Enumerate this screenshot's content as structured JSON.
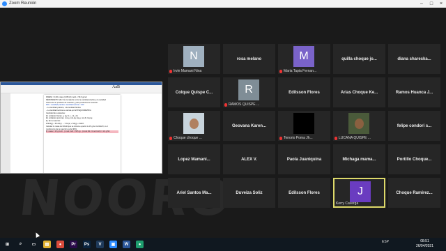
{
  "window": {
    "title": "Zoom Reunión"
  },
  "shared_doc": {
    "ribbon_text": "AaB",
    "lines": [
      "P(REN) = 0,36 moles·(3,05/4,6) mol/L × 59,6 g/mol",
      "",
      "RENDIMIENTO (R) = Es la relación entre la cantidad práctica y la cantidad",
      "teórica de un producto de reacción y para productos de reacción:",
      "R% = cantidad práctica / cantidad teórica × 100",
      "– La cantidad práctica, o la cantidad fáctica",
      "– La cantidad teórica se calcula por ESTEQUIOMETRÍA",
      "Cantidad de sustancias:",
      "En unidades físicas: g, kg, lb, L, mL, dm",
      "En unidades químicas: mol-g, mol-kg, Eq-g, mol-lb, Eq-kg",
      "Ej. En la reacción:",
      "2NH3(g) + 3CuO(s) → 3 Cu(s) + N2(g) + 3H2O",
      "Calcular la masa de N2/H2 que se obtiene a partir de 15 g de CuO/H2O, si el",
      "rendimiento de la reacción es del 90%.",
      "R: masa = 15 g CuO · (1 mol CuO / 79,5 g) · (1 mol N2 / 3 mol CuO) = 1,6 g N2"
    ]
  },
  "watermark": "NOORO",
  "participants": [
    {
      "name": "N",
      "footer": "Irvin Mamani Nina",
      "type": "avatar",
      "color": "#9fb0bf",
      "mic_muted": true
    },
    {
      "name": "rosa melano",
      "footer": "",
      "type": "name",
      "mic_muted": false
    },
    {
      "name": "M",
      "footer": "Maria Tapia Fernan...",
      "type": "avatar",
      "color": "#7a63c9",
      "mic_muted": true
    },
    {
      "name": "quilla choque jo...",
      "footer": "",
      "type": "name",
      "mic_muted": false
    },
    {
      "name": "diana shareska...",
      "footer": "",
      "type": "name",
      "mic_muted": false
    },
    {
      "name": "Colque Quispe C...",
      "footer": "",
      "type": "name",
      "mic_muted": false
    },
    {
      "name": "R",
      "footer": "RAMOS QUISPE ...",
      "type": "avatar",
      "color": "#7f8d96",
      "mic_muted": true
    },
    {
      "name": "Edilsson Flores",
      "footer": "",
      "type": "name",
      "mic_muted": false
    },
    {
      "name": "Arias Choque Ke...",
      "footer": "",
      "type": "name",
      "mic_muted": false
    },
    {
      "name": "Ramos Huanca J...",
      "footer": "",
      "type": "name",
      "mic_muted": false
    },
    {
      "name": "",
      "footer": "Choque choque ...",
      "type": "photo",
      "mic_muted": true
    },
    {
      "name": "Geovana Karen...",
      "footer": "",
      "type": "name",
      "mic_muted": false
    },
    {
      "name": "",
      "footer": "Tenorio Poma Jh...",
      "type": "black",
      "mic_muted": true
    },
    {
      "name": "",
      "footer": "LUCANA QUISPE ...",
      "type": "photo2",
      "mic_muted": true
    },
    {
      "name": "felipe condori s...",
      "footer": "",
      "type": "name",
      "mic_muted": false
    },
    {
      "name": "Lopez Mamani...",
      "footer": "",
      "type": "name",
      "mic_muted": false
    },
    {
      "name": "ALEX V.",
      "footer": "",
      "type": "name",
      "mic_muted": false
    },
    {
      "name": "Paola Juaniquina",
      "footer": "",
      "type": "name",
      "mic_muted": false
    },
    {
      "name": "Michaga mama...",
      "footer": "",
      "type": "name",
      "mic_muted": false
    },
    {
      "name": "Portillo Choque...",
      "footer": "",
      "type": "name",
      "mic_muted": false
    },
    {
      "name": "Ariel Santos Ma...",
      "footer": "",
      "type": "name",
      "mic_muted": false
    },
    {
      "name": "Duveiza Soliz",
      "footer": "",
      "type": "name",
      "mic_muted": false
    },
    {
      "name": "Edilsson Flores",
      "footer": "",
      "type": "name",
      "mic_muted": false
    },
    {
      "name": "J",
      "footer": "Kerry Caverga",
      "type": "avatar",
      "color": "#6a3cc0",
      "mic_muted": false,
      "active": true
    },
    {
      "name": "Choque Ramirez...",
      "footer": "",
      "type": "name",
      "mic_muted": false
    }
  ],
  "taskbar": {
    "apps": [
      {
        "icon": "windows-icon",
        "glyph": "⊞",
        "color": "#101820"
      },
      {
        "icon": "search-icon",
        "glyph": "⌕",
        "color": "#101820"
      },
      {
        "icon": "task-view-icon",
        "glyph": "▭",
        "color": "#101820"
      },
      {
        "icon": "file-explorer-icon",
        "glyph": "▤",
        "color": "#e0b030"
      },
      {
        "icon": "chrome-icon",
        "glyph": "●",
        "color": "#d94b3b"
      },
      {
        "icon": "premiere-icon",
        "glyph": "Pr",
        "color": "#2a0a4a"
      },
      {
        "icon": "photoshop-icon",
        "glyph": "Ps",
        "color": "#0b2540"
      },
      {
        "icon": "vegas-icon",
        "glyph": "V",
        "color": "#1e3a5a"
      },
      {
        "icon": "zoom-icon",
        "glyph": "▣",
        "color": "#2d8cff"
      },
      {
        "icon": "word-icon",
        "glyph": "W",
        "color": "#2b579a"
      },
      {
        "icon": "app-icon",
        "glyph": "●",
        "color": "#1e9e6e"
      }
    ],
    "tray_lang": "ESP",
    "time": "08:51",
    "date": "26/04/2021"
  }
}
